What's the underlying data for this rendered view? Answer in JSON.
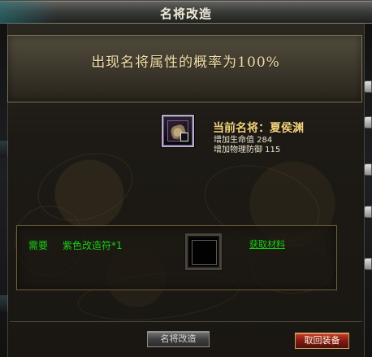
{
  "window": {
    "title": "名将改造"
  },
  "banner": {
    "probability_text": "出现名将属性的概率为100%"
  },
  "general": {
    "icon": "general-portrait-icon",
    "current_label": "当前名将：夏侯渊",
    "stats": [
      "增加生命值 284",
      "增加物理防御 115"
    ]
  },
  "materials": {
    "need_label": "需要",
    "required_item": "紫色改造符*1",
    "get_link": "获取材料",
    "slot_icon": "empty-material-slot-icon"
  },
  "buttons": {
    "reforge": "名将改造",
    "return_equipment": "取回装备"
  },
  "colors": {
    "accent_gold": "#f1d37c",
    "material_green": "#17d117",
    "return_button_red": "#821b14"
  }
}
